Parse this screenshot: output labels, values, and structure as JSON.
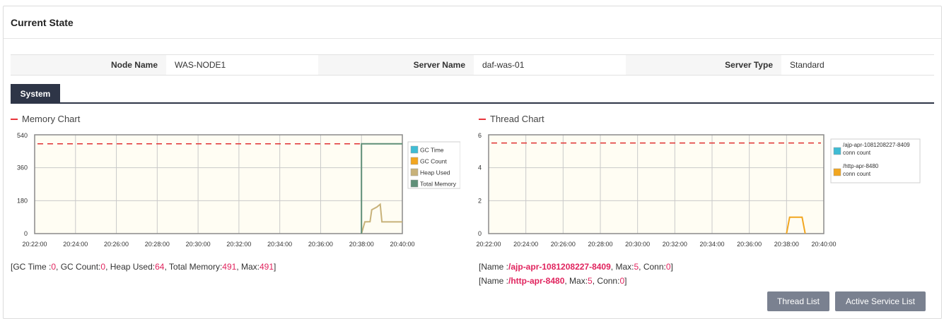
{
  "panel": {
    "title": "Current State"
  },
  "info": {
    "node_name_label": "Node Name",
    "node_name": "WAS-NODE1",
    "server_name_label": "Server Name",
    "server_name": "daf-was-01",
    "server_type_label": "Server Type",
    "server_type": "Standard"
  },
  "tabs": {
    "system": "System"
  },
  "memory": {
    "title": "Memory Chart",
    "summary": {
      "p1": "[GC Time :",
      "gc_time": "0",
      "p2": ", GC Count:",
      "gc_count": "0",
      "p3": ", Heap Used:",
      "heap_used": "64",
      "p4": ", Total Memory:",
      "total_memory": "491",
      "p5": ", Max:",
      "max": "491",
      "p6": "]"
    }
  },
  "thread": {
    "title": "Thread Chart",
    "summary": [
      {
        "p1": "[Name :",
        "name": "/ajp-apr-1081208227-8409",
        "p2": ", Max:",
        "max": "5",
        "p3": ", Conn:",
        "conn": "0",
        "p4": "]"
      },
      {
        "p1": "[Name :",
        "name": "/http-apr-8480",
        "p2": ", Max:",
        "max": "5",
        "p3": ", Conn:",
        "conn": "0",
        "p4": "]"
      }
    ]
  },
  "buttons": {
    "thread_list": "Thread List",
    "active_service_list": "Active Service List"
  },
  "colors": {
    "gc_time": "#3fbcd4",
    "gc_count": "#f2a61f",
    "heap_used": "#c8b27a",
    "total_memory": "#5f8f78",
    "ajp": "#3fbcd4",
    "http": "#f2a61f",
    "max_line": "#e03030",
    "plot_bg": "#fffdf3"
  },
  "chart_data": [
    {
      "type": "line",
      "x": [
        "20:22:00",
        "20:24:00",
        "20:26:00",
        "20:28:00",
        "20:30:00",
        "20:32:00",
        "20:34:00",
        "20:36:00",
        "20:38:00",
        "20:40:00"
      ],
      "ylim": [
        0,
        540
      ],
      "yticks": [
        "540",
        "360",
        "180",
        "0"
      ],
      "legend": "right",
      "series": [
        {
          "name": "GC Time",
          "color": "#3fbcd4",
          "points": []
        },
        {
          "name": "GC Count",
          "color": "#f2a61f",
          "points": []
        },
        {
          "name": "Heap Used",
          "color": "#c8b27a",
          "points": [
            [
              "20:38:00",
              0
            ],
            [
              "20:38:10",
              64
            ],
            [
              "20:38:25",
              65
            ],
            [
              "20:38:30",
              130
            ],
            [
              "20:38:45",
              145
            ],
            [
              "20:38:55",
              160
            ],
            [
              "20:39:00",
              64
            ],
            [
              "20:40:00",
              64
            ]
          ]
        },
        {
          "name": "Total Memory",
          "color": "#5f8f78",
          "points": [
            [
              "20:38:00",
              0
            ],
            [
              "20:38:00",
              491
            ],
            [
              "20:40:00",
              491
            ]
          ]
        }
      ],
      "max_line": 491
    },
    {
      "type": "line",
      "x": [
        "20:22:00",
        "20:24:00",
        "20:26:00",
        "20:28:00",
        "20:30:00",
        "20:32:00",
        "20:34:00",
        "20:36:00",
        "20:38:00",
        "20:40:00"
      ],
      "ylim": [
        0,
        6
      ],
      "yticks": [
        "6",
        "4",
        "2",
        "0"
      ],
      "legend": "right",
      "series": [
        {
          "name": "/ajp-apr-1081208227-8409 conn count",
          "color": "#3fbcd4",
          "points": []
        },
        {
          "name": "/http-apr-8480 conn count",
          "color": "#f2a61f",
          "points": [
            [
              "20:38:00",
              0
            ],
            [
              "20:38:10",
              1
            ],
            [
              "20:38:50",
              1
            ],
            [
              "20:39:00",
              0
            ]
          ]
        }
      ],
      "max_line": 5.5
    }
  ]
}
